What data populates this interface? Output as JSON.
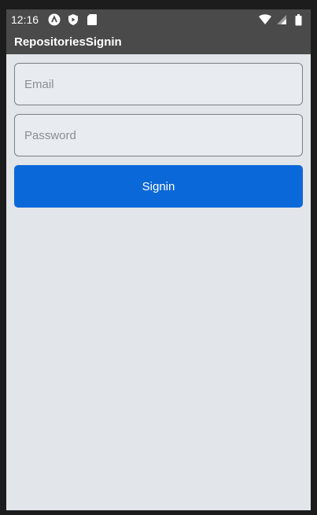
{
  "status_bar": {
    "time": "12:16",
    "left_icons": [
      "notification-a-icon",
      "play-protect-icon",
      "sd-card-icon"
    ],
    "right_icons": [
      "wifi-icon",
      "signal-icon",
      "battery-icon"
    ]
  },
  "app_bar": {
    "title": "RepositoriesSignin"
  },
  "form": {
    "email": {
      "value": "",
      "placeholder": "Email"
    },
    "password": {
      "value": "",
      "placeholder": "Password"
    },
    "signin_label": "Signin"
  },
  "colors": {
    "app_bar": "#4a4a4a",
    "background": "#e2e5ea",
    "button": "#0b68d8"
  }
}
